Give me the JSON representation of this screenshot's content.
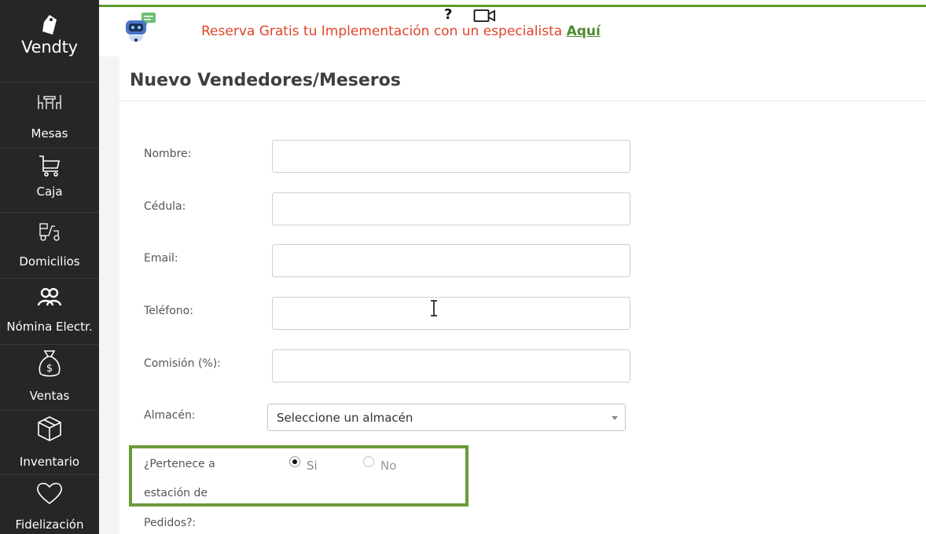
{
  "sidebar": {
    "brand": "Vendty",
    "items": [
      {
        "label": "Mesas",
        "icon": "tables-icon"
      },
      {
        "label": "Caja",
        "icon": "cart-icon"
      },
      {
        "label": "Domicilios",
        "icon": "delivery-scooter-icon"
      },
      {
        "label": "Nómina Electr.",
        "icon": "people-icon"
      },
      {
        "label": "Ventas",
        "icon": "money-bag-icon"
      },
      {
        "label": "Inventario",
        "icon": "box-icon"
      },
      {
        "label": "Fidelización",
        "icon": "heart-icon"
      }
    ]
  },
  "header": {
    "help_label": "?",
    "promo_text": "Reserva Gratis tu Implementación con un especialista ",
    "promo_link": "Aquí",
    "promo_color": "#e0442a",
    "link_color": "#4f8a2e"
  },
  "page": {
    "title": "Nuevo Vendedores/Meseros"
  },
  "form": {
    "nombre_label": "Nombre:",
    "cedula_label": "Cédula:",
    "email_label": "Email:",
    "telefono_label": "Teléfono:",
    "comision_label": "Comisión (%):",
    "almacen_label": "Almacén:",
    "almacen_value": "Seleccione un almacén",
    "estacion_label_1": "¿Pertenece a",
    "estacion_label_2": "estación de",
    "estacion_label_3": "Pedidos?:",
    "option_yes": "Si",
    "option_no": "No",
    "selected_option": "Si"
  },
  "colors": {
    "sidebar_bg": "#262626",
    "accent_green": "#6a9a3a"
  }
}
